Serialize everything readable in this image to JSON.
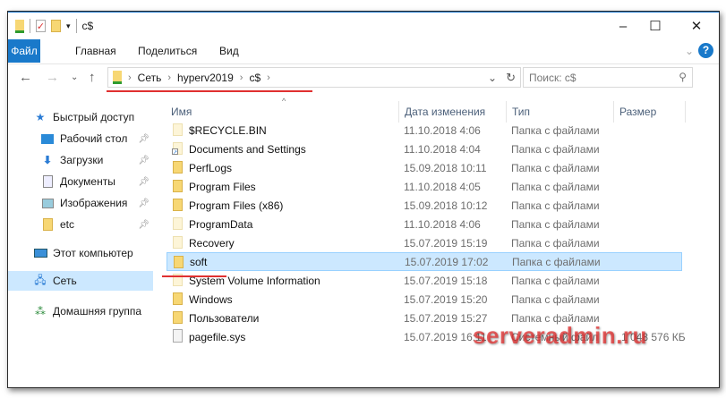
{
  "window": {
    "title": "c$",
    "minimize": "–",
    "maximize": "☐",
    "close": "✕"
  },
  "ribbon": {
    "tabs": [
      "Файл",
      "Главная",
      "Поделиться",
      "Вид"
    ],
    "expand": "⌄",
    "help": "?"
  },
  "nav": {
    "back": "←",
    "forward": "→",
    "recent": "⌄",
    "up": "↑",
    "path": [
      "Сеть",
      "hyperv2019",
      "c$"
    ],
    "refresh": "↻",
    "dropdown": "⌄",
    "search_placeholder": "Поиск: c$",
    "search_icon": "⚲"
  },
  "sidebar": {
    "items": [
      {
        "label": "Быстрый доступ",
        "icon": "star-icon",
        "pinned": false
      },
      {
        "label": "Рабочий стол",
        "icon": "desktop-icon",
        "pinned": true
      },
      {
        "label": "Загрузки",
        "icon": "download-icon",
        "pinned": true
      },
      {
        "label": "Документы",
        "icon": "documents-icon",
        "pinned": true
      },
      {
        "label": "Изображения",
        "icon": "pictures-icon",
        "pinned": true
      },
      {
        "label": "etc",
        "icon": "folder-icon",
        "pinned": true
      },
      {
        "label": "Этот компьютер",
        "icon": "computer-icon",
        "pinned": false
      },
      {
        "label": "Сеть",
        "icon": "network-icon",
        "pinned": false,
        "selected": true
      },
      {
        "label": "Домашняя группа",
        "icon": "homegroup-icon",
        "pinned": false
      }
    ]
  },
  "columns": [
    "Имя",
    "Дата изменения",
    "Тип",
    "Размер"
  ],
  "files": [
    {
      "name": "$RECYCLE.BIN",
      "date": "11.10.2018 4:06",
      "type": "Папка с файлами",
      "size": "",
      "icon": "pale"
    },
    {
      "name": "Documents and Settings",
      "date": "11.10.2018 4:04",
      "type": "Папка с файлами",
      "size": "",
      "icon": "link"
    },
    {
      "name": "PerfLogs",
      "date": "15.09.2018 10:11",
      "type": "Папка с файлами",
      "size": "",
      "icon": "folder"
    },
    {
      "name": "Program Files",
      "date": "11.10.2018 4:05",
      "type": "Папка с файлами",
      "size": "",
      "icon": "folder"
    },
    {
      "name": "Program Files (x86)",
      "date": "15.09.2018 10:12",
      "type": "Папка с файлами",
      "size": "",
      "icon": "folder"
    },
    {
      "name": "ProgramData",
      "date": "11.10.2018 4:06",
      "type": "Папка с файлами",
      "size": "",
      "icon": "pale"
    },
    {
      "name": "Recovery",
      "date": "15.07.2019 15:19",
      "type": "Папка с файлами",
      "size": "",
      "icon": "pale"
    },
    {
      "name": "soft",
      "date": "15.07.2019 17:02",
      "type": "Папка с файлами",
      "size": "",
      "icon": "folder",
      "selected": true
    },
    {
      "name": "System Volume Information",
      "date": "15.07.2019 15:18",
      "type": "Папка с файлами",
      "size": "",
      "icon": "pale"
    },
    {
      "name": "Windows",
      "date": "15.07.2019 15:20",
      "type": "Папка с файлами",
      "size": "",
      "icon": "folder"
    },
    {
      "name": "Пользователи",
      "date": "15.07.2019 15:27",
      "type": "Папка с файлами",
      "size": "",
      "icon": "folder"
    },
    {
      "name": "pagefile.sys",
      "date": "15.07.2019 16:11",
      "type": "Системный файл",
      "size": "1 048 576 КБ",
      "icon": "file"
    }
  ],
  "watermark": "serveradmin.ru",
  "colors": {
    "accent": "#1979ca",
    "selection": "#cce8ff",
    "annotation": "#e03030"
  }
}
